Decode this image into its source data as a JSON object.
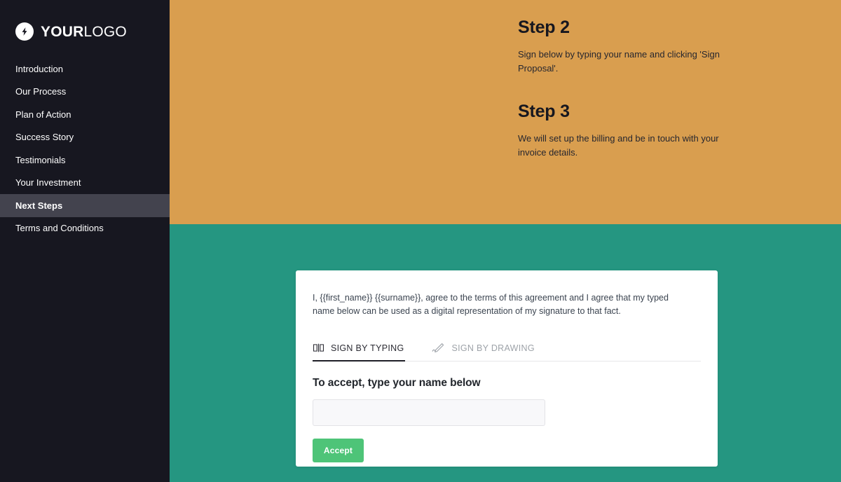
{
  "sidebar": {
    "logo": {
      "icon": "lightning-bolt-icon",
      "text_bold": "YOUR",
      "text_light": "LOGO"
    },
    "items": [
      {
        "label": "Introduction",
        "active": false
      },
      {
        "label": "Our Process",
        "active": false
      },
      {
        "label": "Plan of Action",
        "active": false
      },
      {
        "label": "Success Story",
        "active": false
      },
      {
        "label": "Testimonials",
        "active": false
      },
      {
        "label": "Your Investment",
        "active": false
      },
      {
        "label": "Next Steps",
        "active": true
      },
      {
        "label": "Terms and Conditions",
        "active": false
      }
    ]
  },
  "main": {
    "steps": [
      {
        "heading": "Step 2",
        "body": "Sign below by typing your name and clicking 'Sign Proposal'."
      },
      {
        "heading": "Step 3",
        "body": "We will set up the billing and be in touch with your invoice details."
      }
    ]
  },
  "sign_card": {
    "agreement": "I, {{first_name}} {{surname}}, agree to the terms of this agreement and I agree that my typed name below can be used as a digital representation of my signature to that fact.",
    "tabs": [
      {
        "label": "SIGN BY TYPING",
        "icon": "type-signature-icon",
        "active": true
      },
      {
        "label": "SIGN BY DRAWING",
        "icon": "pen-signature-icon",
        "active": false
      }
    ],
    "accept_title": "To accept, type your name below",
    "name_input": {
      "value": "",
      "placeholder": ""
    },
    "accept_button": "Accept"
  },
  "colors": {
    "sidebar_bg": "#171720",
    "sidebar_active_bg": "#43434e",
    "band_orange": "#d99e4f",
    "band_teal": "#259681",
    "accept_green": "#4ec478",
    "card_bg": "#ffffff"
  }
}
